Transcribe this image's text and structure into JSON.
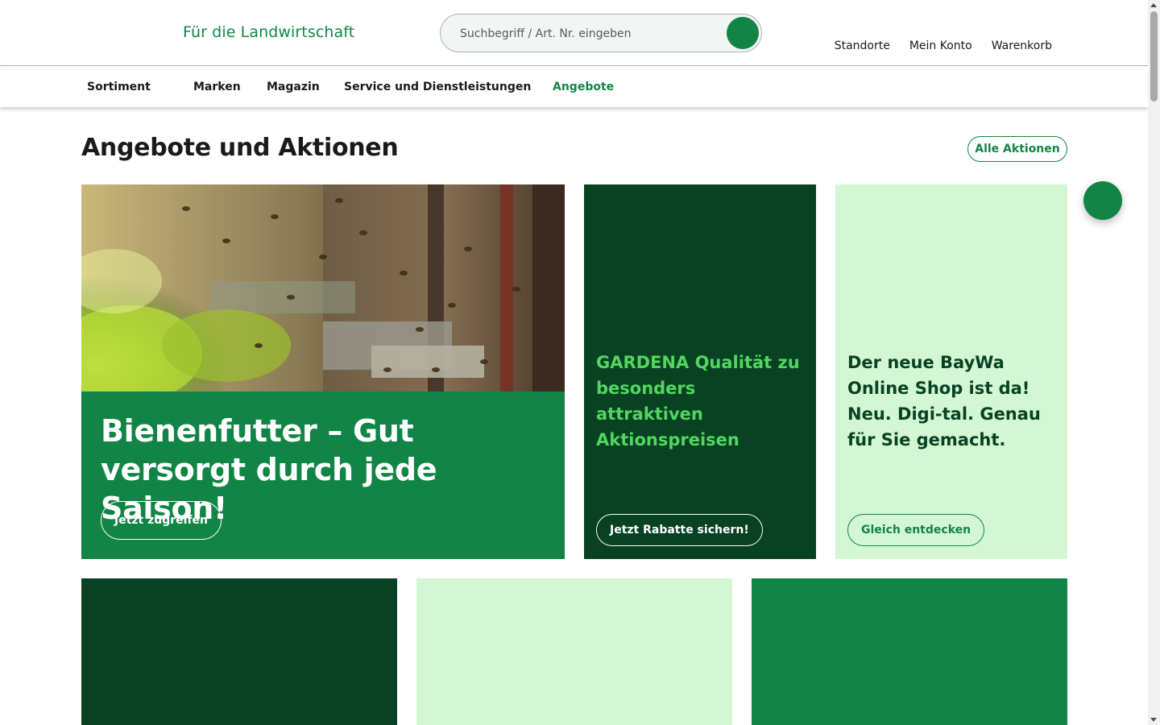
{
  "header": {
    "tagline": "Für die Landwirtschaft",
    "search_placeholder": "Suchbegriff / Art. Nr. eingeben",
    "links": [
      "Standorte",
      "Mein Konto",
      "Warenkorb"
    ]
  },
  "nav": {
    "items": [
      "Sortiment",
      "Marken",
      "Magazin",
      "Service und Dienstleistungen",
      "Angebote"
    ],
    "active": "Angebote"
  },
  "section": {
    "title": "Angebote und Aktionen",
    "all_button": "Alle Aktionen"
  },
  "cards": [
    {
      "title": "Bienenfutter – Gut versorgt durch jede Saison!",
      "button": "Jetzt zugreifen",
      "image": "beehive-photo"
    },
    {
      "title": "GARDENA Qualität zu besonders attraktiven Aktionspreisen",
      "button": "Jetzt Rabatte sichern!"
    },
    {
      "title": "Der neue BayWa Online Shop ist da! Neu. Digi-tal. Genau für Sie gemacht.",
      "button": "Gleich entdecken"
    }
  ],
  "colors": {
    "brand_green": "#118545",
    "dark_green": "#084223",
    "light_green": "#d3f7d3",
    "lime_text": "#52d660"
  }
}
